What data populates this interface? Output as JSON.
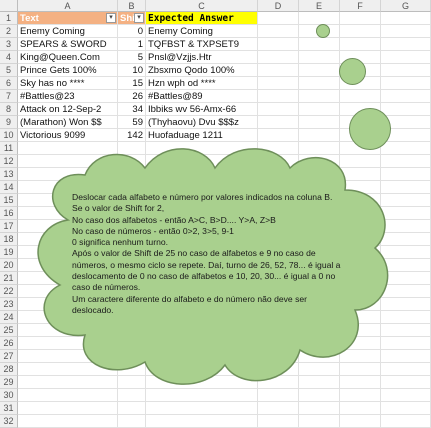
{
  "columns": [
    "A",
    "B",
    "C",
    "D",
    "E",
    "F",
    "G"
  ],
  "rows": [
    "1",
    "2",
    "3",
    "4",
    "5",
    "6",
    "7",
    "8",
    "9",
    "10",
    "11",
    "12",
    "13",
    "14",
    "15",
    "16",
    "17",
    "18",
    "19",
    "20",
    "21",
    "22",
    "23",
    "24",
    "25",
    "26",
    "27",
    "28",
    "29",
    "30",
    "31",
    "32"
  ],
  "headers": {
    "text": "Text",
    "shift": "Shi",
    "expected": "Expected Answer"
  },
  "data": [
    {
      "text": "Enemy Coming",
      "shift": "0",
      "expected": "Enemy Coming"
    },
    {
      "text": "SPEARS & SWORD",
      "shift": "1",
      "expected": "TQFBST & TXPSET9"
    },
    {
      "text": "King@Queen.Com",
      "shift": "5",
      "expected": "Pnsl@Vzjjs.Htr"
    },
    {
      "text": "Prince Gets 100%",
      "shift": "10",
      "expected": "Zbsxmo Qodo 100%"
    },
    {
      "text": "Sky has no ****",
      "shift": "15",
      "expected": "Hzn wph od ****"
    },
    {
      "text": "#Battles@23",
      "shift": "26",
      "expected": "#Battles@89"
    },
    {
      "text": "Attack on 12-Sep-2",
      "shift": "34",
      "expected": "Ibbiks wv 56-Amx-66"
    },
    {
      "text": "(Marathon) Won $$",
      "shift": "59",
      "expected": "(Thyhaovu) Dvu $$$z"
    },
    {
      "text": "Victorious 9099",
      "shift": "142",
      "expected": "Huofaduage 1211"
    }
  ],
  "note": {
    "lines": [
      "Deslocar cada alfabeto e número por valores indicados na coluna B.",
      "Se o valor de Shift for 2,",
      "No caso dos alfabetos - então A>C, B>D.... Y>A, Z>B",
      "No caso de números - então 0>2, 3>5, 9-1",
      "0 significa nenhum turno.",
      "Após o valor de Shift de 25 no caso de alfabetos e 9 no caso de números, o mesmo ciclo se repete. Daí, turno de 26, 52, 78... é igual a deslocamento de 0 no caso de alfabetos e 10, 20, 30... é igual a 0 no caso de números.",
      "Um caractere diferente do alfabeto e do número não deve ser deslocado."
    ]
  },
  "colors": {
    "header_orange": "#f4b183",
    "header_yellow": "#ffff00",
    "cloud_fill": "#a9d08e",
    "cloud_border": "#6e8f5a"
  }
}
